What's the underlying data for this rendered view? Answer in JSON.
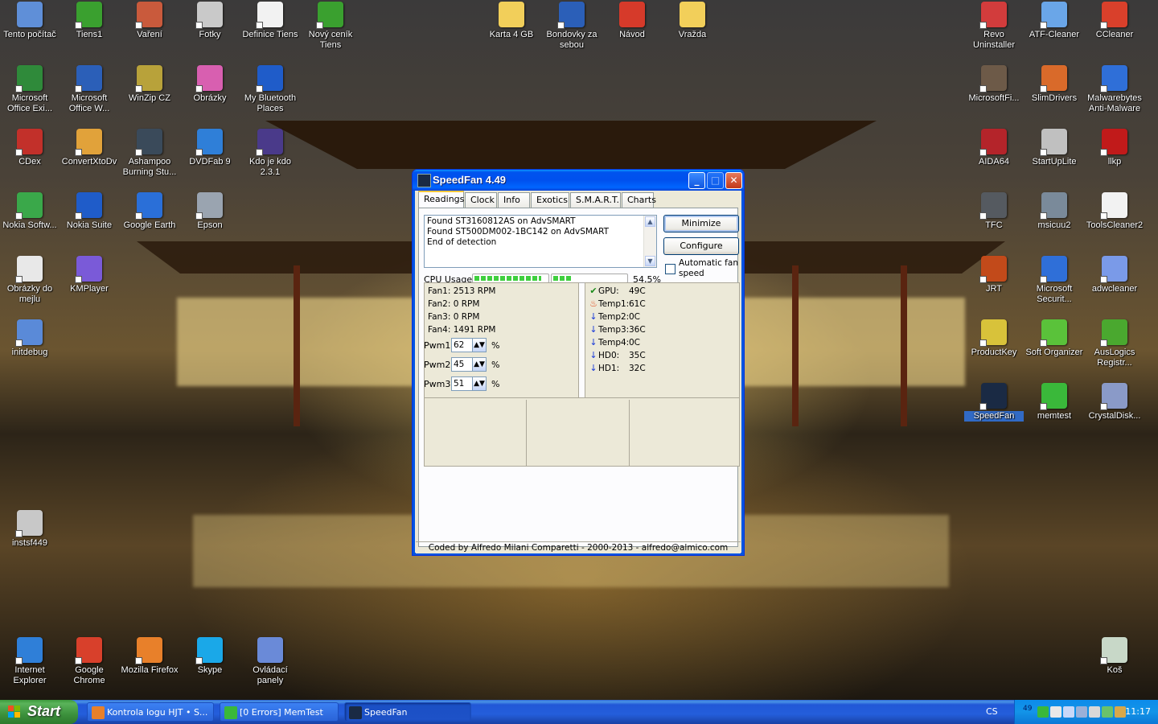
{
  "desktop": {
    "icons": [
      {
        "label": "Tento počítač",
        "color": "#5f8fd8"
      },
      {
        "label": "Tiens1",
        "color": "#3aa02f"
      },
      {
        "label": "Vaření",
        "color": "#c95a3c"
      },
      {
        "label": "Fotky",
        "color": "#c9c9c9"
      },
      {
        "label": "Definice Tiens",
        "color": "#f2f2f2"
      },
      {
        "label": "Nový ceník Tiens",
        "color": "#3aa02f"
      },
      {
        "label": "Karta 4 GB",
        "color": "#f2cf5a"
      },
      {
        "label": "Bondovky  za sebou",
        "color": "#2b5fb8"
      },
      {
        "label": "Návod",
        "color": "#d63a2a"
      },
      {
        "label": "Vražda",
        "color": "#f2cf5a"
      },
      {
        "label": "Revo Uninstaller",
        "color": "#d23c3c"
      },
      {
        "label": "ATF-Cleaner",
        "color": "#6aa6e8"
      },
      {
        "label": "CCleaner",
        "color": "#d9402b"
      },
      {
        "label": "Microsoft Office Exi...",
        "color": "#2f8a3a"
      },
      {
        "label": "Microsoft Office W...",
        "color": "#2b5fb8"
      },
      {
        "label": "WinZip CZ",
        "color": "#b8a23a"
      },
      {
        "label": "Obrázky",
        "color": "#d85fb0"
      },
      {
        "label": "My Bluetooth Places",
        "color": "#1f5cc9"
      },
      {
        "label": "MicrosoftFi...",
        "color": "#6d5a48"
      },
      {
        "label": "SlimDrivers",
        "color": "#d96a2a"
      },
      {
        "label": "Malwarebytes Anti-Malware",
        "color": "#2f6fd8"
      },
      {
        "label": "CDex",
        "color": "#c2302a"
      },
      {
        "label": "ConvertXtoDv",
        "color": "#e1a23a"
      },
      {
        "label": "Ashampoo Burning Stu...",
        "color": "#3a4a5a"
      },
      {
        "label": "DVDFab 9",
        "color": "#2f7fd8"
      },
      {
        "label": "Kdo je kdo 2.3.1",
        "color": "#4a3a8a"
      },
      {
        "label": "AIDA64",
        "color": "#b4242a"
      },
      {
        "label": "StartUpLite",
        "color": "#c0c0c0"
      },
      {
        "label": "llkp",
        "color": "#c11a1a"
      },
      {
        "label": "Nokia Softw...",
        "color": "#3aa84a"
      },
      {
        "label": "Nokia Suite",
        "color": "#1f5cc9"
      },
      {
        "label": "Google Earth",
        "color": "#2a6fd8"
      },
      {
        "label": "Epson",
        "color": "#9aa4b0"
      },
      {
        "label": "TFC",
        "color": "#555a60"
      },
      {
        "label": "msicuu2",
        "color": "#7a8a9a"
      },
      {
        "label": "ToolsCleaner2",
        "color": "#f2f2f2"
      },
      {
        "label": "Obrázky do mejlu",
        "color": "#e8e8e8"
      },
      {
        "label": "KMPlayer",
        "color": "#7a5ad8"
      },
      {
        "label": "JRT",
        "color": "#c24a1a"
      },
      {
        "label": "Microsoft Securit...",
        "color": "#2f6fd8"
      },
      {
        "label": "adwcleaner",
        "color": "#7a9ae8"
      },
      {
        "label": "initdebug",
        "color": "#5a8ad8"
      },
      {
        "label": "ProductKey",
        "color": "#d8c23a"
      },
      {
        "label": "Soft Organizer",
        "color": "#5ac23a"
      },
      {
        "label": "AusLogics Registr...",
        "color": "#4aa82f"
      },
      {
        "label": "SpeedFan",
        "color": "#1a2a44"
      },
      {
        "label": "memtest",
        "color": "#3ab83a"
      },
      {
        "label": "CrystalDisk...",
        "color": "#8a9ac8"
      },
      {
        "label": "instsf449",
        "color": "#c8c8c8"
      },
      {
        "label": "Internet Explorer",
        "color": "#2f7fd8"
      },
      {
        "label": "Google Chrome",
        "color": "#d8402b"
      },
      {
        "label": "Mozilla Firefox",
        "color": "#e8802a"
      },
      {
        "label": "Skype",
        "color": "#1aa8e8"
      },
      {
        "label": "Ovládací panely",
        "color": "#6a8ad8"
      },
      {
        "label": "Koš",
        "color": "#c8d8c8"
      }
    ]
  },
  "speedfan": {
    "title": "SpeedFan 4.49",
    "tabs": [
      "Readings",
      "Clock",
      "Info",
      "Exotics",
      "S.M.A.R.T.",
      "Charts"
    ],
    "log": [
      "Found ST3160812AS on AdvSMART",
      "Found ST500DM002-1BC142 on AdvSMART",
      "End of detection"
    ],
    "minimize_label": "Minimize",
    "configure_label": "Configure",
    "auto_fan_label": "Automatic fan speed",
    "auto_fan_checked": false,
    "cpu_label": "CPU Usage",
    "cpu_pct": "54,5%",
    "cpu_core_levels": [
      0.92,
      0.24
    ],
    "fans": [
      "Fan1: 2513 RPM",
      "Fan2: 0 RPM",
      "Fan3: 0 RPM",
      "Fan4: 1491 RPM"
    ],
    "temps": [
      {
        "icon": "check-icon",
        "name": "GPU:",
        "value": "49C",
        "color": "#1a8a1a"
      },
      {
        "icon": "flame-icon",
        "name": "Temp1:",
        "value": "61C",
        "color": "#e2461a"
      },
      {
        "icon": "arrow-down-icon",
        "name": "Temp2:",
        "value": "0C",
        "color": "#1a3ad8"
      },
      {
        "icon": "arrow-down-icon",
        "name": "Temp3:",
        "value": "36C",
        "color": "#1a3ad8"
      },
      {
        "icon": "arrow-down-icon",
        "name": "Temp4:",
        "value": "0C",
        "color": "#1a3ad8"
      },
      {
        "icon": "arrow-down-icon",
        "name": "HD0:",
        "value": "35C",
        "color": "#1a3ad8"
      },
      {
        "icon": "arrow-down-icon",
        "name": "HD1:",
        "value": "32C",
        "color": "#1a3ad8"
      }
    ],
    "pwm": [
      {
        "label": "Pwm1:",
        "value": "62",
        "unit": "%"
      },
      {
        "label": "Pwm2:",
        "value": "45",
        "unit": "%"
      },
      {
        "label": "Pwm3:",
        "value": "51",
        "unit": "%"
      }
    ],
    "status": "Coded by Alfredo Milani Comparetti - 2000-2013 - alfredo@almico.com"
  },
  "taskbar": {
    "start_label": "Start",
    "tasks": [
      {
        "label": "Kontrola logu HJT • S...",
        "color": "#e8802a"
      },
      {
        "label": "[0 Errors] MemTest",
        "color": "#3ab83a"
      },
      {
        "label": "SpeedFan",
        "color": "#1a2a44"
      }
    ],
    "lang": "CS",
    "tray_temp": "49",
    "clock": "11:17"
  }
}
